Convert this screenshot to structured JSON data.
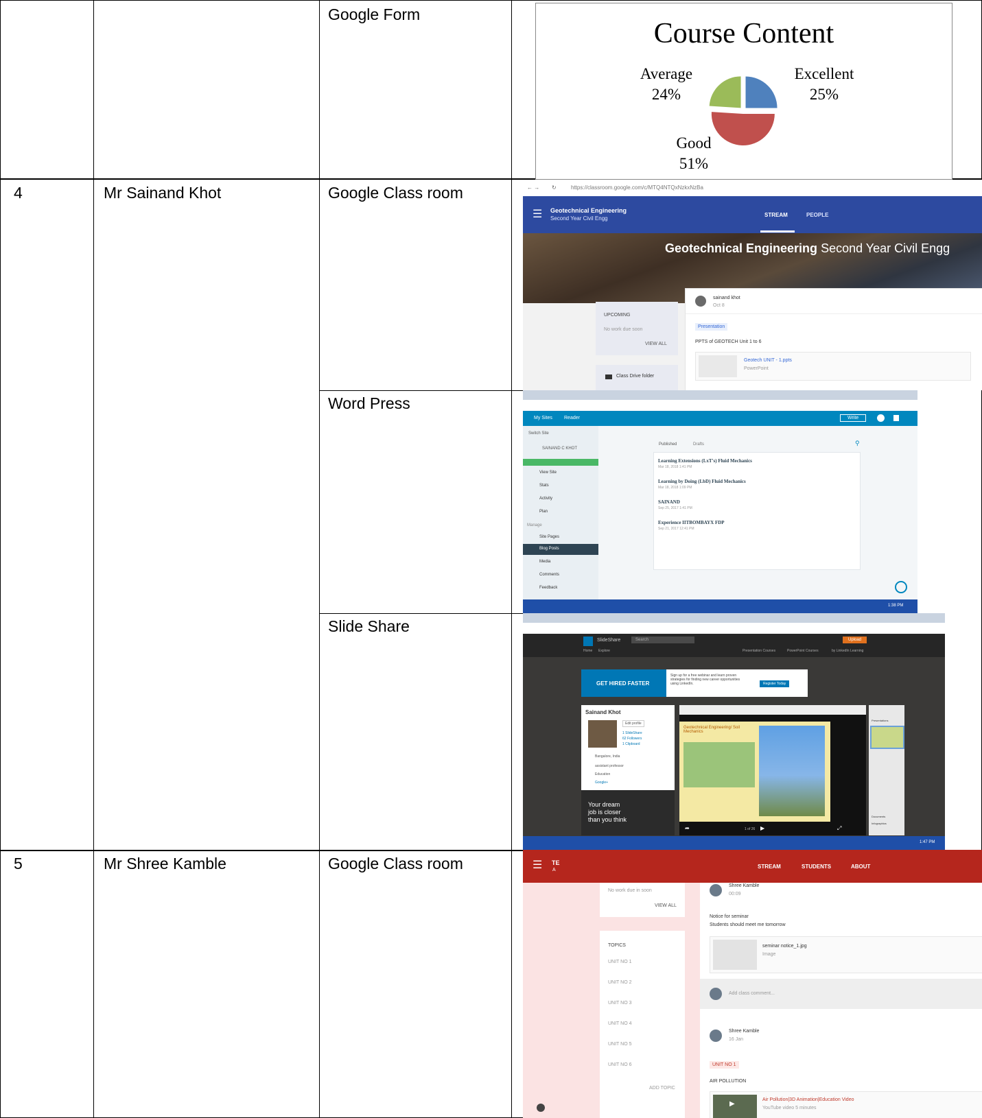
{
  "rows": [
    {
      "num": "",
      "name": "",
      "tool": "Google Form"
    },
    {
      "num": "4",
      "name": "Mr Sainand Khot",
      "tools": [
        "Google Class room",
        "Word Press",
        "Slide Share"
      ]
    },
    {
      "num": "5",
      "name": "Mr Shree Kamble",
      "tool": "Google Class room"
    }
  ],
  "chart_data": {
    "type": "pie",
    "title": "Course Content",
    "categories": [
      "Excellent",
      "Good",
      "Average"
    ],
    "values": [
      25,
      51,
      24
    ],
    "labels": [
      "25%",
      "51%",
      "24%"
    ],
    "colors": [
      "#4f81bd",
      "#c0504d",
      "#9bbb59"
    ]
  },
  "gc1": {
    "url": "https://classroom.google.com/c/MTQ4NTQxNzkxNzBa",
    "course_title": "Geotechnical Engineering",
    "course_subtitle": "Second Year Civil Engg",
    "tab_stream": "STREAM",
    "tab_people": "PEOPLE",
    "banner_title": "Geotechnical Engineering",
    "banner_subtitle": "Second Year Civil Engg",
    "upcoming": "UPCOMING",
    "no_work": "No work due soon",
    "view_all": "VIEW ALL",
    "class_drive": "Class Drive folder",
    "author": "sainand khot",
    "date": "Oct 8",
    "chip": "Presentation",
    "post_text": "PPTS of GEOTECH Unit 1 to 6",
    "attachment": "Geotech UNIT - 1.ppts",
    "attachment_type": "PowerPoint"
  },
  "wp": {
    "my_sites": "My Sites",
    "reader": "Reader",
    "write": "Write",
    "switch_site": "Switch Site",
    "site_name": "SAINAND C KHOT",
    "menu": [
      "View Site",
      "Stats",
      "Activity",
      "Plan",
      "Manage",
      "Site Pages",
      "Blog Posts",
      "Media",
      "Comments",
      "Feedback"
    ],
    "tab_published": "Published",
    "tab_drafts": "Drafts",
    "posts": [
      {
        "title": "Learning Extensions (LxT's) Fluid Mechanics",
        "date": "Mar 18, 2018 1:41 PM"
      },
      {
        "title": "Learning by Doing (LbD) Fluid Mechanics",
        "date": "Mar 18, 2018 1:09 PM"
      },
      {
        "title": "SAINAND",
        "date": "Sep 25, 2017 1:41 PM"
      },
      {
        "title": "Experience IITBOMBAYX FDP",
        "date": "Sep 21, 2017 12:41 PM"
      }
    ],
    "clock": "1:38 PM"
  },
  "ss": {
    "brand": "SlideShare",
    "search": "Search",
    "upload": "Upload",
    "nav": [
      "Home",
      "Explore"
    ],
    "nav_right": [
      "Presentation Courses",
      "PowerPoint Courses",
      "by LinkedIn Learning"
    ],
    "ad_title": "GET HIRED FASTER",
    "ad_text": "Sign up for a free webinar and learn proven strategies for finding new career opportunities using LinkedIn.",
    "ad_button": "Register Today",
    "profile_name": "Sainand Khot",
    "edit_profile": "Edit profile",
    "stats": [
      "1 SlideShare",
      "62 Followers",
      "1 Clipboard"
    ],
    "details": [
      "Bangalore, India",
      "assistant professor",
      "Education",
      "Google+"
    ],
    "dream": "Your dream job is closer than you think",
    "slide_title": "Geotechnical Engineering/ Soil Mechanics",
    "presentations": "Presentations",
    "documents": "Documents",
    "infographics": "Infographics",
    "page": "1 of 26",
    "clock": "1:47 PM"
  },
  "gc2": {
    "code": "TE",
    "code_sub": "A",
    "tab_stream": "STREAM",
    "tab_students": "STUDENTS",
    "tab_about": "ABOUT",
    "no_work": "No work due in soon",
    "view_all": "VIEW ALL",
    "topics": "TOPICS",
    "units": [
      "UNIT NO 1",
      "UNIT NO 2",
      "UNIT NO 3",
      "UNIT NO 4",
      "UNIT NO 5",
      "UNIT NO 6"
    ],
    "add_topic": "ADD TOPIC",
    "author": "Shree Kamble",
    "time": "00:09",
    "post_line1": "Notice for seminar",
    "post_line2": "Students should meet me tomorrow",
    "attachment": "seminar notice_1.jpg",
    "attachment_type": "Image",
    "comment_placeholder": "Add class comment...",
    "author2": "Shree Kamble",
    "date2": "16 Jan",
    "chip": "UNIT NO 1",
    "post2": "AIR POLLUTION",
    "video_title": "Air Pollution|3D Animation|Education Video",
    "video_meta": "YouTube video   5 minutes"
  }
}
